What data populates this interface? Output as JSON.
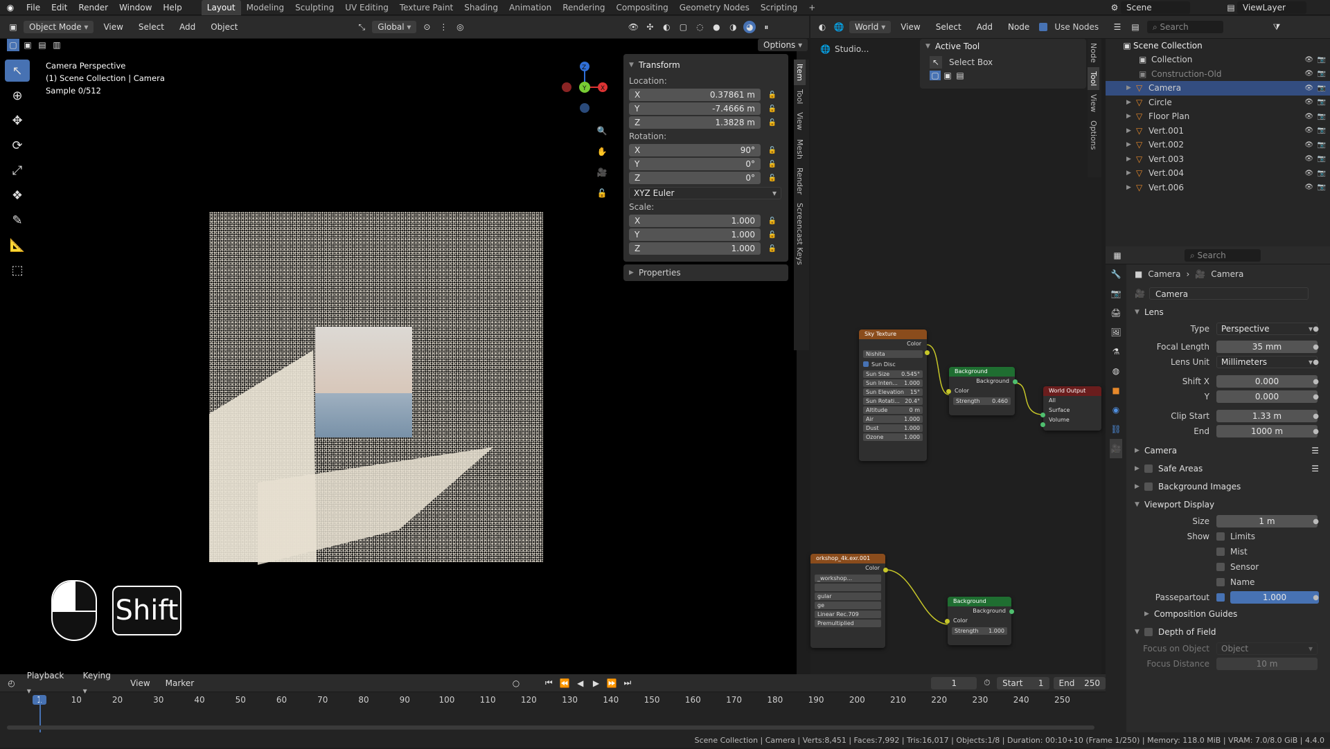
{
  "topbar": {
    "menus": [
      "File",
      "Edit",
      "Render",
      "Window",
      "Help"
    ],
    "workspaces": [
      "Layout",
      "Modeling",
      "Sculpting",
      "UV Editing",
      "Texture Paint",
      "Shading",
      "Animation",
      "Rendering",
      "Compositing",
      "Geometry Nodes",
      "Scripting"
    ],
    "scene": "Scene",
    "view_layer": "ViewLayer"
  },
  "viewport_header": {
    "mode": "Object Mode",
    "menus": [
      "View",
      "Select",
      "Add",
      "Object"
    ],
    "transform": "Global",
    "options": "Options"
  },
  "viewport": {
    "overlay": [
      "Camera Perspective",
      "(1) Scene Collection | Camera",
      "Sample 0/512"
    ],
    "key_hint": "Shift"
  },
  "npanel": {
    "transform": "Transform",
    "location_label": "Location:",
    "location": [
      {
        "axis": "X",
        "value": "0.37861 m"
      },
      {
        "axis": "Y",
        "value": "-7.4666 m"
      },
      {
        "axis": "Z",
        "value": "1.3828 m"
      }
    ],
    "rotation_label": "Rotation:",
    "rotation": [
      {
        "axis": "X",
        "value": "90°"
      },
      {
        "axis": "Y",
        "value": "0°"
      },
      {
        "axis": "Z",
        "value": "0°"
      }
    ],
    "rotation_mode": "XYZ Euler",
    "scale_label": "Scale:",
    "scale": [
      {
        "axis": "X",
        "value": "1.000"
      },
      {
        "axis": "Y",
        "value": "1.000"
      },
      {
        "axis": "Z",
        "value": "1.000"
      }
    ],
    "properties": "Properties",
    "tabs": [
      "Item",
      "Tool",
      "View",
      "Mesh",
      "Render",
      "Screencast Keys"
    ]
  },
  "node_header": {
    "world": "World",
    "menus": [
      "View",
      "Select",
      "Add",
      "Node"
    ],
    "use_nodes": "Use Nodes",
    "breadcrumb": "Studio...",
    "active_tool": "Active Tool",
    "select_box": "Select Box",
    "tabs": [
      "Node",
      "Tool",
      "View",
      "Options"
    ]
  },
  "nodes": {
    "sky": {
      "title": "Sky Texture",
      "out": "Color",
      "type": "Nishita",
      "sun_disc": "Sun Disc",
      "fields": [
        [
          "Sun Size",
          "0.545°"
        ],
        [
          "Sun Inten...",
          "1.000"
        ],
        [
          "Sun Elevation",
          "15°"
        ],
        [
          "Sun Rotati...",
          "20.4°"
        ],
        [
          "Altitude",
          "0 m"
        ],
        [
          "Air",
          "1.000"
        ],
        [
          "Dust",
          "1.000"
        ],
        [
          "Ozone",
          "1.000"
        ]
      ]
    },
    "bg1": {
      "title": "Background",
      "out": "Background",
      "color": "Color",
      "strength": "Strength",
      "strength_val": "0.460"
    },
    "world_out": {
      "title": "World Output",
      "all": "All",
      "surface": "Surface",
      "volume": "Volume"
    },
    "img": {
      "title": "orkshop_4k.exr.001",
      "out": "Color",
      "file": "_workshop...",
      "f1": "gular",
      "f2": "ge",
      "f3": "Linear Rec.709",
      "f4": "Premultiplied"
    },
    "bg2": {
      "title": "Background",
      "out": "Background",
      "color": "Color",
      "strength": "Strength",
      "strength_val": "1.000"
    }
  },
  "outliner": {
    "search": "Search",
    "root": "Scene Collection",
    "items": [
      {
        "name": "Collection"
      },
      {
        "name": "Construction-Old"
      },
      {
        "name": "Camera"
      },
      {
        "name": "Circle"
      },
      {
        "name": "Floor Plan"
      },
      {
        "name": "Vert.001"
      },
      {
        "name": "Vert.002"
      },
      {
        "name": "Vert.003"
      },
      {
        "name": "Vert.004"
      },
      {
        "name": "Vert.006"
      }
    ]
  },
  "properties": {
    "search": "Search",
    "breadcrumb_obj": "Camera",
    "breadcrumb_data": "Camera",
    "datablock": "Camera",
    "lens": "Lens",
    "type_label": "Type",
    "type": "Perspective",
    "focal_label": "Focal Length",
    "focal": "35 mm",
    "unit_label": "Lens Unit",
    "unit": "Millimeters",
    "shiftx_label": "Shift X",
    "shiftx": "0.000",
    "shifty_label": "Y",
    "shifty": "0.000",
    "clipstart_label": "Clip Start",
    "clipstart": "1.33 m",
    "clipend_label": "End",
    "clipend": "1000 m",
    "camera": "Camera",
    "safe_areas": "Safe Areas",
    "bg_images": "Background Images",
    "viewport_display": "Viewport Display",
    "size_label": "Size",
    "size": "1 m",
    "show_label": "Show",
    "limits": "Limits",
    "mist": "Mist",
    "sensor": "Sensor",
    "name": "Name",
    "passepartout_label": "Passepartout",
    "passepartout": "1.000",
    "composition": "Composition Guides",
    "dof": "Depth of Field",
    "focus_obj_label": "Focus on Object",
    "focus_obj_placeholder": "Object",
    "focus_dist_label": "Focus Distance",
    "focus_dist": "10 m"
  },
  "timeline": {
    "menus": [
      "Playback",
      "Keying",
      "View",
      "Marker"
    ],
    "frame": "1",
    "start_label": "Start",
    "start": "1",
    "end_label": "End",
    "end": "250",
    "ticks": [
      "1",
      "10",
      "20",
      "30",
      "40",
      "50",
      "60",
      "70",
      "80",
      "90",
      "100",
      "110",
      "120",
      "130",
      "140",
      "150",
      "160",
      "170",
      "180",
      "190",
      "200",
      "210",
      "220",
      "230",
      "240",
      "250"
    ]
  },
  "status": "Scene Collection | Camera | Verts:8,451 | Faces:7,992 | Tris:16,017 | Objects:1/8 | Duration: 00:10+10 (Frame 1/250) | Memory: 118.0 MiB | VRAM: 7.0/8.0 GiB | 4.4.0"
}
